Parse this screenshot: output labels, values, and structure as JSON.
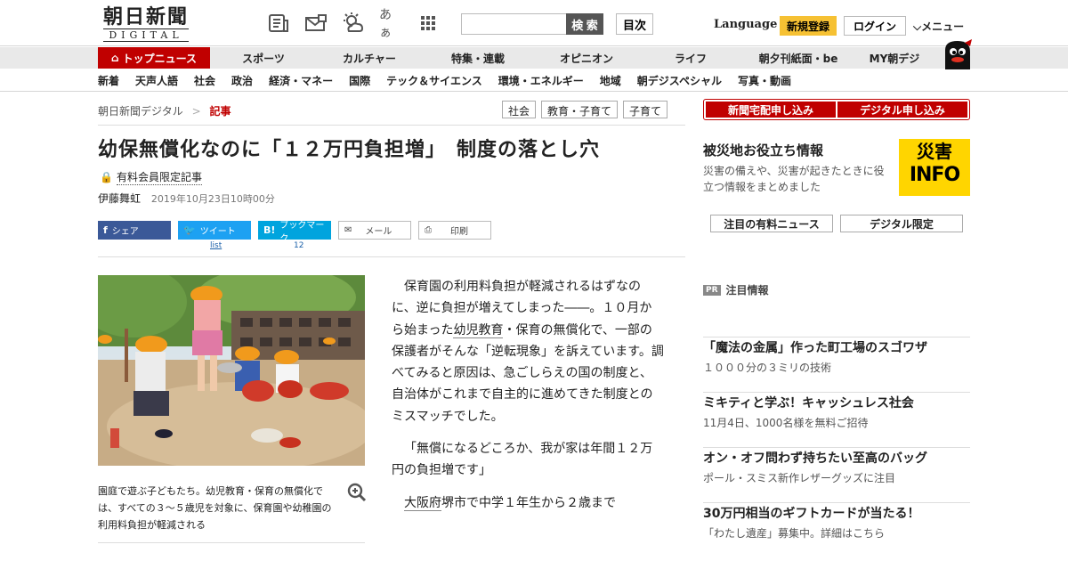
{
  "header": {
    "logo_main": "朝日新聞",
    "logo_sub": "DIGITAL",
    "icons": [
      "newspaper-icon",
      "mail-icon",
      "weather-icon",
      "font-size-icon",
      "grid-menu-icon"
    ],
    "font_icon_text": "あぁ",
    "search_button": "検 索",
    "toc_button": "目次",
    "language": "Language",
    "signup": "新規登録",
    "login": "ログイン",
    "menu": "メニュー"
  },
  "nav1": [
    "トップニュース",
    "スポーツ",
    "カルチャー",
    "特集・連載",
    "オピニオン",
    "ライフ",
    "朝夕刊紙面・be",
    "MY朝デジ"
  ],
  "nav2": [
    "新着",
    "天声人語",
    "社会",
    "政治",
    "経済・マネー",
    "国際",
    "テック＆サイエンス",
    "環境・エネルギー",
    "地域",
    "朝デジスペシャル",
    "写真・動画"
  ],
  "breadcrumb": {
    "home": "朝日新聞デジタル",
    "sep": ">",
    "current": "記事"
  },
  "tags": [
    "社会",
    "教育・子育て",
    "子育て"
  ],
  "article": {
    "headline": "幼保無償化なのに「１２万円負担増」　制度の落とし穴",
    "paid_label": "有料会員限定記事",
    "author": "伊藤舞虹",
    "date": "2019年10月23日10時00分",
    "caption": "園庭で遊ぶ子どもたち。幼児教育・保育の無償化では、すべての３～５歳児を対象に、保育園や幼稚園の利用料負担が軽減される",
    "p1_a": "保育園の利用料負担が軽減されるはずなのに、逆に負担が増えてしまった――。１０月から始まった",
    "p1_link": "幼児教育",
    "p1_b": "・保育の無償化で、一部の保護者がそんな「逆転現象」を訴えています。調べてみると原因は、急ごしらえの国の制度と、自治体がこれまで自主的に進めてきた制度とのミスマッチでした。",
    "p2": "「無償になるどころか、我が家は年間１２万円の負担増です」",
    "p3_link": "大阪府",
    "p3_b": "堺市で中学１年生から２歳まで"
  },
  "share": {
    "facebook": "シェア",
    "twitter": "ツイート",
    "hatena": "ブックマーク",
    "mail": "メール",
    "print": "印刷",
    "twitter_count": "list",
    "hatena_count": "12"
  },
  "sidebar": {
    "btn_delivery": "新聞宅配申し込み",
    "btn_digital": "デジタル申し込み",
    "disaster_title": "被災地お役立ち情報",
    "disaster_desc": "災害の備えや、災害が起きたときに役立つ情報をまとめました",
    "disaster_badge_top": "災害",
    "disaster_badge_bottom": "INFO",
    "tab1": "注目の有料ニュース",
    "tab2": "デジタル限定",
    "pr_badge": "PR",
    "pr_label": "注目情報",
    "pr_items": [
      {
        "title": "「魔法の金属」作った町工場のスゴワザ",
        "sub": "１０００分の３ミリの技術"
      },
      {
        "title": "ミキティと学ぶ！キャッシュレス社会",
        "sub": "11月4日、1000名様を無料ご招待"
      },
      {
        "title": "オン・オフ問わず持ちたい至高のバッグ",
        "sub": "ポール・スミス新作レザーグッズに注目"
      },
      {
        "title": "30万円相当のギフトカードが当たる！",
        "sub": "「わたし遺産」募集中。詳細はこちら"
      }
    ]
  },
  "colors": {
    "accent_red": "#c00000",
    "signup_yellow": "#f6c133",
    "disaster_yellow": "#ffd500"
  }
}
